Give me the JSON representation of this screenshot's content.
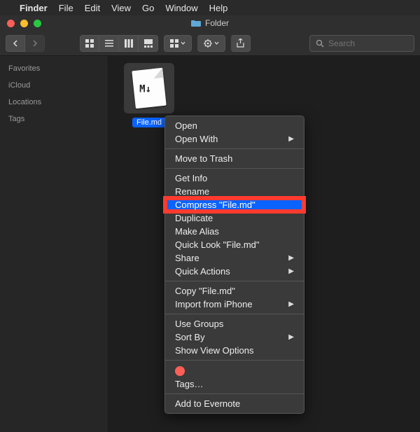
{
  "menubar": {
    "app": "Finder",
    "items": [
      "File",
      "Edit",
      "View",
      "Go",
      "Window",
      "Help"
    ]
  },
  "window": {
    "title": "Folder"
  },
  "toolbar": {
    "search_placeholder": "Search"
  },
  "sidebar": {
    "items": [
      "Favorites",
      "iCloud",
      "Locations",
      "Tags"
    ]
  },
  "file": {
    "name": "File.md",
    "glyph": "M↓"
  },
  "context_menu": {
    "items": [
      {
        "label": "Open",
        "submenu": false
      },
      {
        "label": "Open With",
        "submenu": true
      },
      {
        "sep": true
      },
      {
        "label": "Move to Trash",
        "submenu": false
      },
      {
        "sep": true
      },
      {
        "label": "Get Info",
        "submenu": false
      },
      {
        "label": "Rename",
        "submenu": false
      },
      {
        "label": "Compress \"File.md\"",
        "submenu": false,
        "highlighted": true
      },
      {
        "label": "Duplicate",
        "submenu": false
      },
      {
        "label": "Make Alias",
        "submenu": false
      },
      {
        "label": "Quick Look \"File.md\"",
        "submenu": false
      },
      {
        "label": "Share",
        "submenu": true
      },
      {
        "label": "Quick Actions",
        "submenu": true
      },
      {
        "sep": true
      },
      {
        "label": "Copy \"File.md\"",
        "submenu": false
      },
      {
        "label": "Import from iPhone",
        "submenu": true
      },
      {
        "sep": true
      },
      {
        "label": "Use Groups",
        "submenu": false
      },
      {
        "label": "Sort By",
        "submenu": true
      },
      {
        "label": "Show View Options",
        "submenu": false
      },
      {
        "sep": true
      },
      {
        "tags_row": true
      },
      {
        "label": "Tags…",
        "submenu": false
      },
      {
        "sep": true
      },
      {
        "label": "Add to Evernote",
        "submenu": false
      }
    ]
  }
}
